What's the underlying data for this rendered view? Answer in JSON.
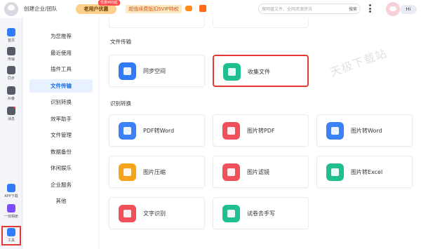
{
  "header": {
    "create_team": "创建企业/团队",
    "old_user_promo": "老用户优惠",
    "coupon_badge": "优惠¥60起",
    "svip_promo": "超值续费抵扣SVIP特权",
    "search": {
      "placeholder": "搜网盘文件、全网资源资讯",
      "button": "搜索"
    },
    "greeting": "Hi"
  },
  "rail": {
    "items": [
      {
        "label": "首页",
        "icon": "home-icon",
        "color": "#2f7cf6"
      },
      {
        "label": "传输",
        "icon": "transfer-icon",
        "color": "#555a66"
      },
      {
        "label": "同步",
        "icon": "sync-icon",
        "color": "#555a66"
      },
      {
        "label": "AI番",
        "icon": "ai-icon",
        "color": "#555a66"
      },
      {
        "label": "消息",
        "icon": "message-icon",
        "color": "#555a66"
      },
      {
        "label": "APP下载",
        "icon": "phone-icon",
        "color": "#2f7cf6"
      },
      {
        "label": "一刻相册",
        "icon": "album-icon",
        "color": "#7c4dff"
      },
      {
        "label": "工具",
        "icon": "tools-icon",
        "color": "#2f7cf6"
      }
    ]
  },
  "subnav": {
    "items": [
      "为您推荐",
      "最近使用",
      "插件工具",
      "文件传输",
      "识别转换",
      "效率助手",
      "文件管理",
      "数据备份",
      "休闲娱乐",
      "企业服务",
      "其他"
    ],
    "active_index": 3
  },
  "sections": {
    "file_transfer": {
      "title": "文件传输",
      "cards": [
        {
          "label": "同步空间",
          "icon": "sync-space-icon",
          "color": "#2f7cf6"
        },
        {
          "label": "收集文件",
          "icon": "collect-files-icon",
          "color": "#1fbf8f"
        }
      ]
    },
    "recognition": {
      "title": "识别转换",
      "cards": [
        {
          "label": "PDF转Word",
          "icon": "pdf-to-word-icon",
          "color": "#3b82f6"
        },
        {
          "label": "图片转PDF",
          "icon": "image-to-pdf-icon",
          "color": "#f0505a"
        },
        {
          "label": "图片转Word",
          "icon": "image-to-word-icon",
          "color": "#3b82f6"
        },
        {
          "label": "图片压缩",
          "icon": "image-compress-icon",
          "color": "#f7a21b"
        },
        {
          "label": "图片滤镜",
          "icon": "image-filter-icon",
          "color": "#f0505a"
        },
        {
          "label": "图片转Excel",
          "icon": "image-to-excel-icon",
          "color": "#1fbf8f"
        },
        {
          "label": "文字识别",
          "icon": "ocr-icon",
          "color": "#f0505a"
        },
        {
          "label": "试卷去手写",
          "icon": "remove-handwriting-icon",
          "color": "#1fbf8f"
        }
      ]
    }
  },
  "watermark": "天极下载站"
}
